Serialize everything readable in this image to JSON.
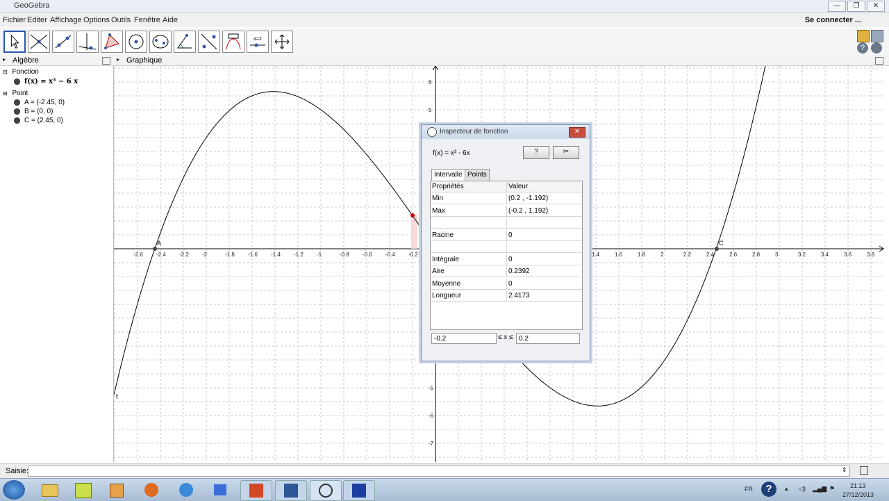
{
  "window": {
    "title": "GeoGebra",
    "controls": [
      "—",
      "❐",
      "✕"
    ]
  },
  "menu": {
    "items": [
      "Fichier",
      "Editer",
      "Affichage",
      "Options",
      "Outils",
      "Fenêtre",
      "Aide"
    ],
    "connect": "Se connecter ..."
  },
  "toolbar": {
    "tools": [
      "move-tool",
      "point-tool",
      "line-tool",
      "perpendicular-tool",
      "polygon-tool",
      "circle-tool",
      "conic-tool",
      "angle-tool",
      "reflect-tool",
      "slider-tool",
      "text-tool",
      "move-view-tool"
    ]
  },
  "algebra": {
    "title": "Algèbre",
    "group_function": "Fonction",
    "function_def": "f(x) = x³ − 6 x",
    "group_point": "Point",
    "points": [
      "A = (-2.45, 0)",
      "B = (0, 0)",
      "C = (2.45, 0)"
    ]
  },
  "graphics": {
    "title": "Graphique",
    "x_ticks": [
      "-2.6",
      "-2.4",
      "-2.2",
      "-2",
      "-1.8",
      "-1.6",
      "-1.4",
      "-1.2",
      "-1",
      "-0.8",
      "-0.6",
      "-0.4",
      "-0.2",
      "1.4",
      "1.6",
      "1.8",
      "2",
      "2.2",
      "2.4",
      "2.6",
      "2.8",
      "3",
      "3.2",
      "3.4",
      "3.6",
      "3.8"
    ],
    "y_ticks": [
      "6",
      "5",
      "-5",
      "-6",
      "-7"
    ],
    "point_labels": [
      "A",
      "C"
    ],
    "curve_label": "f"
  },
  "inspector": {
    "title": "Inspecteur de fonction",
    "function": "f(x) = x³ - 6x",
    "help_label": "?",
    "tools_label": "✂",
    "tabs": [
      "Intervalle",
      "Points"
    ],
    "headers": [
      "Propriétés",
      "Valeur"
    ],
    "rows": [
      [
        "Min",
        "(0.2 , -1.192)"
      ],
      [
        "Max",
        "(-0.2 , 1.192)"
      ],
      [
        "",
        ""
      ],
      [
        "Racine",
        "0"
      ],
      [
        "",
        ""
      ],
      [
        "Intégrale",
        "0"
      ],
      [
        "Aire",
        "0.2392"
      ],
      [
        "Moyenne",
        "0"
      ],
      [
        "Longueur",
        "2.4173"
      ]
    ],
    "range_from": "-0.2",
    "range_symbol": "≤ x ≤",
    "range_to": "0.2"
  },
  "inputbar": {
    "label": "Saisie:"
  },
  "taskbar": {
    "lang": "FR",
    "time": "21:13",
    "date": "27/12/2013"
  }
}
